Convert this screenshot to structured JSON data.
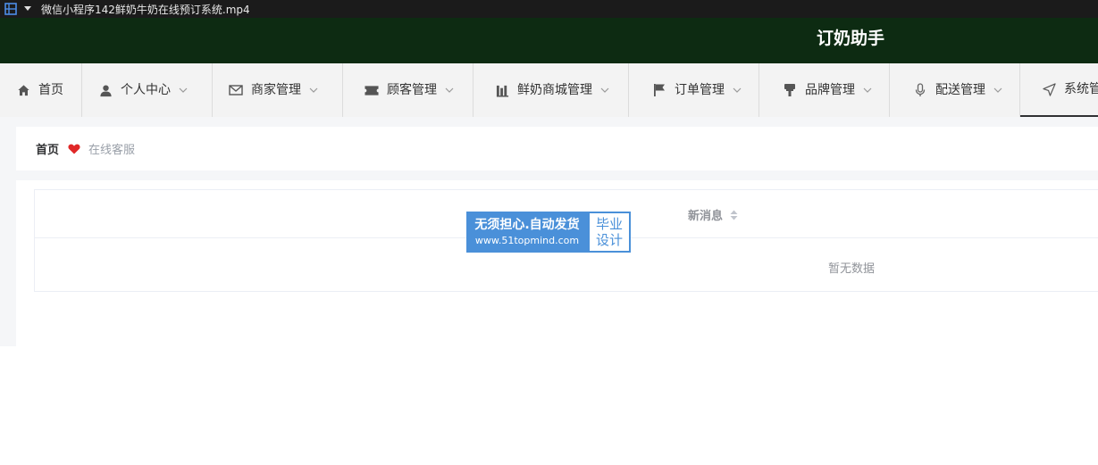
{
  "player": {
    "title": "微信小程序142鲜奶牛奶在线预订系统.mp4",
    "icon": "film-strip-icon"
  },
  "header": {
    "title": "订奶助手"
  },
  "nav": {
    "items": [
      {
        "label": "首页",
        "icon": "home-icon",
        "has_dropdown": false
      },
      {
        "label": "个人中心",
        "icon": "user-icon",
        "has_dropdown": true
      },
      {
        "label": "商家管理",
        "icon": "mail-icon",
        "has_dropdown": true
      },
      {
        "label": "顾客管理",
        "icon": "ticket-icon",
        "has_dropdown": true
      },
      {
        "label": "鲜奶商城管理",
        "icon": "bar-chart-icon",
        "has_dropdown": true
      },
      {
        "label": "订单管理",
        "icon": "flag-icon",
        "has_dropdown": true
      },
      {
        "label": "品牌管理",
        "icon": "stamp-icon",
        "has_dropdown": true
      },
      {
        "label": "配送管理",
        "icon": "microphone-icon",
        "has_dropdown": true
      },
      {
        "label": "系统管理",
        "icon": "send-icon",
        "has_dropdown": true,
        "active": true
      }
    ]
  },
  "breadcrumb": {
    "home": "首页",
    "current": "在线客服",
    "separator_icon": "heart-icon",
    "separator_color": "#e02828"
  },
  "table": {
    "columns": [
      {
        "label": "新消息",
        "sortable": true
      }
    ],
    "rows": [],
    "empty_text": "暂无数据"
  },
  "watermark": {
    "line1": "无须担心.自动发货",
    "line2": "www.51topmind.com",
    "badge_top": "毕业",
    "badge_bottom": "设计"
  },
  "colors": {
    "header_bg": "#0d2b12",
    "nav_bg": "#f3f3f3",
    "watermark_blue": "#4a90d9"
  }
}
